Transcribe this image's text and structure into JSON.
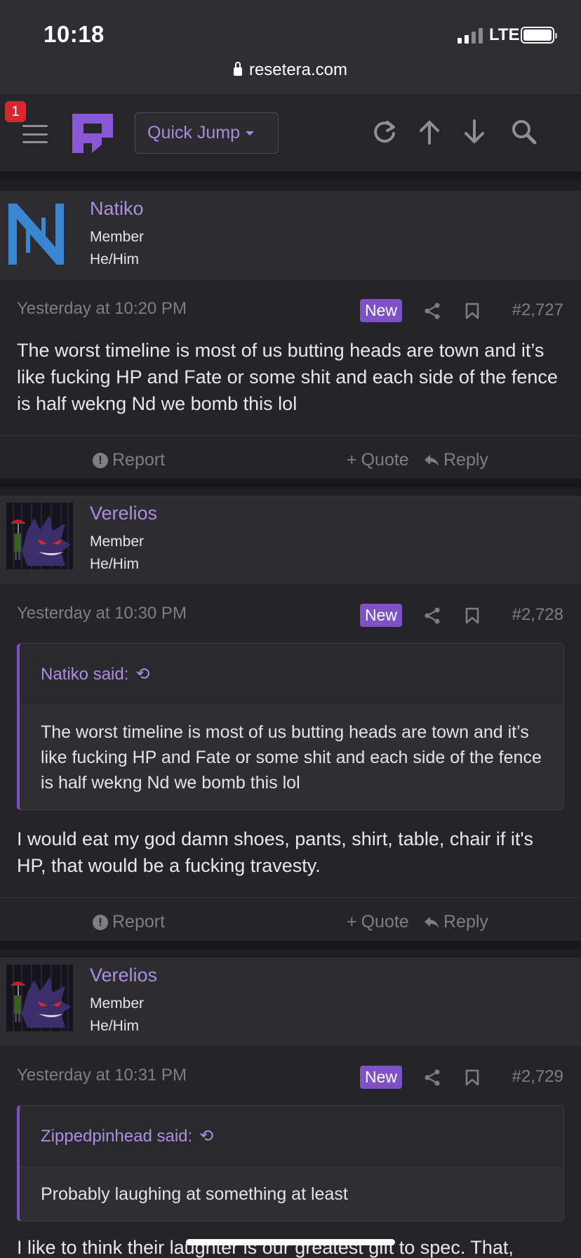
{
  "status": {
    "time": "10:18",
    "network": "LTE"
  },
  "browser": {
    "url": "resetera.com"
  },
  "nav": {
    "notification_count": "1",
    "quick_jump_label": "Quick Jump",
    "accent_color": "#a98ae0"
  },
  "posts": [
    {
      "username": "Natiko",
      "role": "Member",
      "pronouns": "He/Him",
      "timestamp": "Yesterday at 10:20 PM",
      "new_label": "New",
      "post_number": "#2,727",
      "text": "The worst timeline is most of us butting heads are town and it’s like fucking HP and Fate or some shit and each side of the fence is half wekng Nd we bomb this lol",
      "actions": {
        "report": "Report",
        "quote": "Quote",
        "reply": "Reply"
      }
    },
    {
      "username": "Verelios",
      "role": "Member",
      "pronouns": "He/Him",
      "timestamp": "Yesterday at 10:30 PM",
      "new_label": "New",
      "post_number": "#2,728",
      "quote": {
        "author_said": "Natiko said:",
        "text": "The worst timeline is most of us butting heads are town and it’s like fucking HP and Fate or some shit and each side of the fence is half wekng Nd we bomb this lol"
      },
      "text": "I would eat my god damn shoes, pants, shirt, table, chair if it's HP, that would be a fucking travesty.",
      "actions": {
        "report": "Report",
        "quote": "Quote",
        "reply": "Reply"
      }
    },
    {
      "username": "Verelios",
      "role": "Member",
      "pronouns": "He/Him",
      "timestamp": "Yesterday at 10:31 PM",
      "new_label": "New",
      "post_number": "#2,729",
      "quote": {
        "author_said": "Zippedpinhead said:",
        "text": "Probably laughing at something at least"
      },
      "text": "I like to think their laughter is our greatest gift to spec. That,"
    }
  ]
}
